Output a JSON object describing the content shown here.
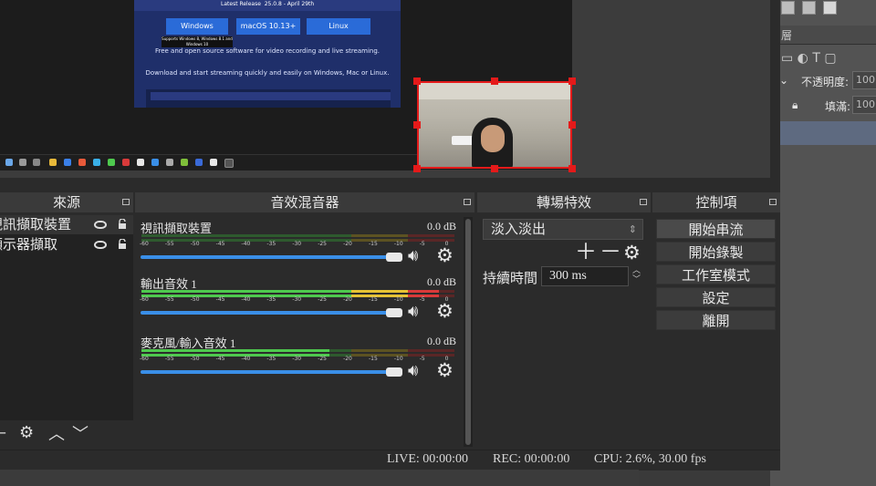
{
  "preview": {
    "website": {
      "latest_release": "Latest Release",
      "release_date": "25.0.8 - April 29th",
      "buttons": [
        "Windows",
        "macOS 10.13+",
        "Linux"
      ],
      "tooltip": "Supports Windows 8, Windows 8.1 and Windows 10",
      "tagline": "Free and open source software for video recording and live streaming.",
      "subtitle": "Download and start streaming quickly and easily on Windows, Mac or Linux."
    }
  },
  "photoshop": {
    "opacity_label": "不透明度:",
    "opacity_value": "100",
    "fill_label": "填滿:",
    "fill_value": "100"
  },
  "sources": {
    "title": "來源",
    "items": [
      {
        "label": "視訊擷取裝置",
        "selected": true
      },
      {
        "label": "顯示器擷取",
        "selected": false
      }
    ]
  },
  "mixer": {
    "title": "音效混音器",
    "ticks": [
      "-60",
      "-55",
      "-50",
      "-45",
      "-40",
      "-35",
      "-30",
      "-25",
      "-20",
      "-15",
      "-10",
      "-5",
      "0"
    ],
    "channels": [
      {
        "name": "視訊擷取裝置",
        "db": "0.0 dB",
        "level": 0.0
      },
      {
        "name": "輸出音效 1",
        "db": "0.0 dB",
        "level": 0.95
      },
      {
        "name": "麥克風/輸入音效 1",
        "db": "0.0 dB",
        "level": 0.6
      }
    ]
  },
  "transitions": {
    "title": "轉場特效",
    "selected": "淡入淡出",
    "duration_label": "持續時間",
    "duration_value": "300 ms"
  },
  "controls": {
    "title": "控制項",
    "buttons": [
      "開始串流",
      "開始錄製",
      "工作室模式",
      "設定",
      "離開"
    ]
  },
  "status": {
    "live": "LIVE: 00:00:00",
    "rec": "REC: 00:00:00",
    "cpu": "CPU: 2.6%, 30.00 fps"
  },
  "colors": {
    "selection_red": "#e41a1a",
    "accent_blue": "#3a8fe8",
    "meter_green": "#4ec94e",
    "meter_yellow": "#e6c234",
    "meter_red": "#d83a3a"
  }
}
